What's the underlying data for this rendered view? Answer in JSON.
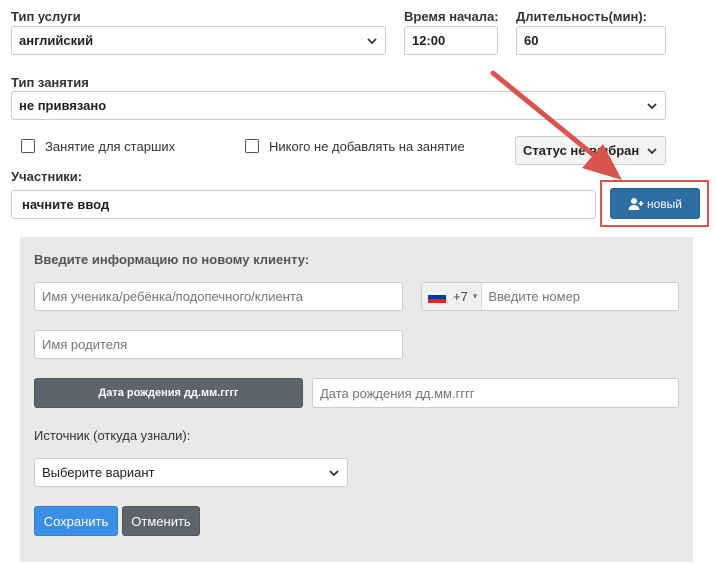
{
  "form": {
    "service_type": {
      "label": "Тип услуги",
      "value": "английский"
    },
    "start_time": {
      "label": "Время начала:",
      "value": "12:00"
    },
    "duration": {
      "label": "Длительность(мин):",
      "value": "60"
    },
    "lesson_type": {
      "label": "Тип занятия",
      "value": "не привязано"
    },
    "senior_checkbox": {
      "label": "Занятие для старших",
      "checked": false
    },
    "no_add_checkbox": {
      "label": "Никого не добавлять на занятие",
      "checked": false
    },
    "status_select": {
      "value": "Статус не выбран"
    },
    "participants": {
      "label": "Участники:",
      "placeholder": "начните ввод"
    },
    "new_button": {
      "label": "новый"
    }
  },
  "new_client_panel": {
    "title": "Введите информацию по новому клиенту:",
    "client_name_placeholder": "Имя ученика/ребёнка/подопечного/клиента",
    "phone_code": "+7",
    "phone_placeholder": "Введите номер",
    "parent_name_placeholder": "Имя родителя",
    "birthdate_button": "Дата рождения дд.мм.гггг",
    "birthdate_placeholder": "Дата рождения дд.мм.гггг",
    "source_label": "Источник (откуда узнали):",
    "source_select": "Выберите вариант",
    "save_button": "Сохранить",
    "cancel_button": "Отменить"
  },
  "colors": {
    "accent": "#2e6da4",
    "save": "#3a8ee6",
    "secondary": "#5d646b",
    "annotation": "#d9534f",
    "panel_bg": "#e9e9e9"
  }
}
